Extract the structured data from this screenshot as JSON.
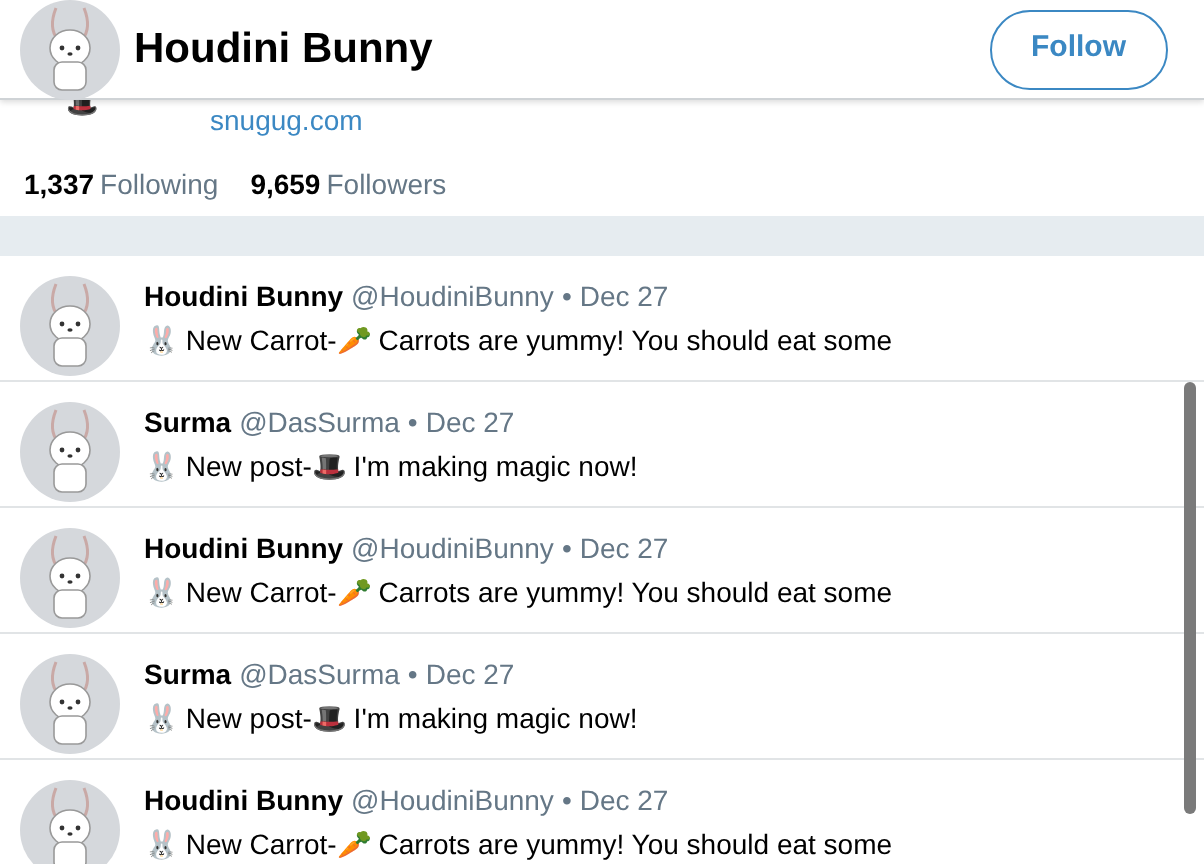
{
  "header": {
    "name": "Houdini Bunny",
    "follow_button": "Follow"
  },
  "profile": {
    "emoji": "🎩",
    "website": "snugug.com",
    "stats": [
      {
        "count": "1,337",
        "label": "Following"
      },
      {
        "count": "9,659",
        "label": "Followers"
      }
    ]
  },
  "tweets": [
    {
      "name": "Houdini Bunny",
      "handle": "@HoudiniBunny",
      "separator": "•",
      "date": "Dec 27",
      "text": "🐰 New Carrot-🥕 Carrots are yummy! You should eat some"
    },
    {
      "name": "Surma",
      "handle": "@DasSurma",
      "separator": "•",
      "date": "Dec 27",
      "text": "🐰 New post-🎩 I'm making magic now!"
    },
    {
      "name": "Houdini Bunny",
      "handle": "@HoudiniBunny",
      "separator": "•",
      "date": "Dec 27",
      "text": "🐰 New Carrot-🥕 Carrots are yummy! You should eat some"
    },
    {
      "name": "Surma",
      "handle": "@DasSurma",
      "separator": "•",
      "date": "Dec 27",
      "text": "🐰 New post-🎩 I'm making magic now!"
    },
    {
      "name": "Houdini Bunny",
      "handle": "@HoudiniBunny",
      "separator": "•",
      "date": "Dec 27",
      "text": "🐰 New Carrot-🥕 Carrots are yummy! You should eat some"
    }
  ]
}
